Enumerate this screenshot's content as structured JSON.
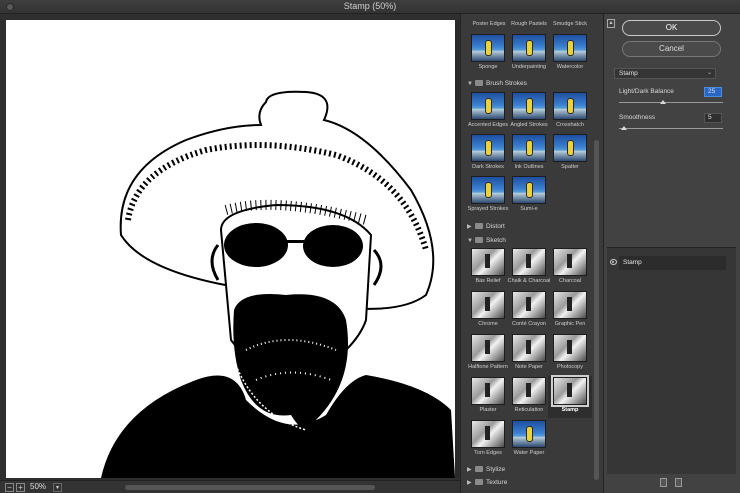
{
  "window": {
    "title": "Stamp (50%)"
  },
  "preview": {
    "zoom": "50%",
    "zoom_out": "−",
    "zoom_in": "+"
  },
  "gallery": {
    "top_row_labels": [
      "Poster Edges",
      "Rough Pastels",
      "Smudge Stick"
    ],
    "artistic_row": [
      "Sponge",
      "Underpainting",
      "Watercolor"
    ],
    "categories": {
      "brush_strokes": "Brush Strokes",
      "distort": "Distort",
      "sketch": "Sketch",
      "stylize": "Stylize",
      "texture": "Texture"
    },
    "brush_strokes_items": [
      "Accented Edges",
      "Angled Strokes",
      "Crosshatch",
      "Dark Strokes",
      "Ink Outlines",
      "Spatter",
      "Sprayed Strokes",
      "Sumi-e"
    ],
    "sketch_items": [
      "Bas Relief",
      "Chalk & Charcoal",
      "Charcoal",
      "Chrome",
      "Conté Crayon",
      "Graphic Pen",
      "Halftone Pattern",
      "Note Paper",
      "Photocopy",
      "Plaster",
      "Reticulation",
      "Stamp",
      "Torn Edges",
      "Water Paper"
    ],
    "selected": "Stamp"
  },
  "panel": {
    "ok_label": "OK",
    "cancel_label": "Cancel",
    "filter_select": "Stamp",
    "params": [
      {
        "label": "Light/Dark Balance",
        "value": "25",
        "fraction": 0.42
      },
      {
        "label": "Smoothness",
        "value": "5",
        "fraction": 0.05
      }
    ],
    "layer_name": "Stamp"
  },
  "colors": {
    "accent": "#2a67c5",
    "background": "#3b3b3b"
  }
}
